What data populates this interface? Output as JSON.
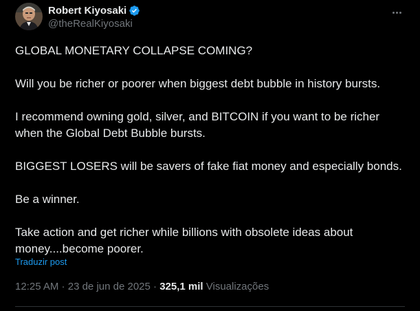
{
  "author": {
    "display_name": "Robert Kiyosaki",
    "handle": "@theRealKiyosaki",
    "verified_color": "#1d9bf0"
  },
  "tweet": {
    "paragraphs": [
      "GLOBAL MONETARY COLLAPSE COMING?",
      "Will you be richer or poorer when biggest debt bubble  in history bursts.",
      "I recommend owning gold, silver, and BITCOIN if you want to be richer\nwhen the Global Debt Bubble bursts.",
      "BIGGEST LOSERS will be savers of fake fiat money and especially bonds.",
      "Be a winner.",
      "Take action and get richer while billions with obsolete ideas about\nmoney....become poorer."
    ],
    "translate_label": "Traduzir post"
  },
  "meta": {
    "time": "12:25 AM",
    "separator": " · ",
    "date": "23 de jun de 2025",
    "views_count": "325,1 mil",
    "views_label": "Visualizações"
  },
  "colors": {
    "background": "#000000",
    "text": "#e7e9ea",
    "secondary": "#71767b",
    "link": "#1d9bf0",
    "divider": "#2f3336"
  }
}
